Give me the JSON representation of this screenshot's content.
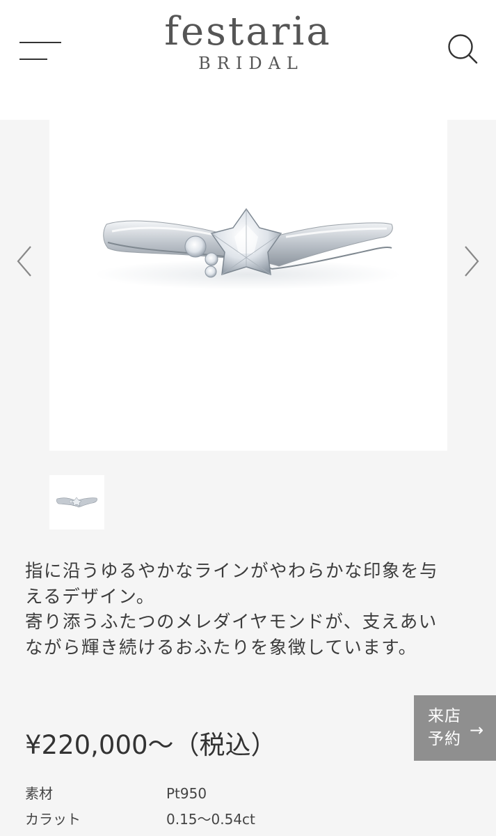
{
  "header": {
    "brand": "festaria",
    "brand_sub": "BRIDAL",
    "menu_icon": "hamburger-menu-icon",
    "search_icon": "search-icon"
  },
  "gallery": {
    "main_image": "platinum-engagement-ring-image",
    "thumbnail": "ring-thumbnail-image",
    "prev_icon": "chevron-left-icon",
    "next_icon": "chevron-right-icon"
  },
  "description": {
    "line1": "指に沿うゆるやかなラインがやわらかな印象を与",
    "line2": "えるデザイン。",
    "line3": "寄り添うふたつのメレダイヤモンドが、支えあい",
    "line4": "ながら輝き続けるおふたりを象徴しています。"
  },
  "visit_button": {
    "label_line1": "来店",
    "label_line2": "予約",
    "arrow": "→"
  },
  "price": "¥220,000〜（税込）",
  "specs": [
    {
      "label": "素材",
      "value": "Pt950"
    },
    {
      "label": "カラット",
      "value": "0.15〜0.54ct"
    }
  ],
  "colors": {
    "background": "#f5f5f5",
    "header_bg": "#ffffff",
    "text": "#3a3a3a",
    "visit_button_bg": "#8f8f8f"
  }
}
